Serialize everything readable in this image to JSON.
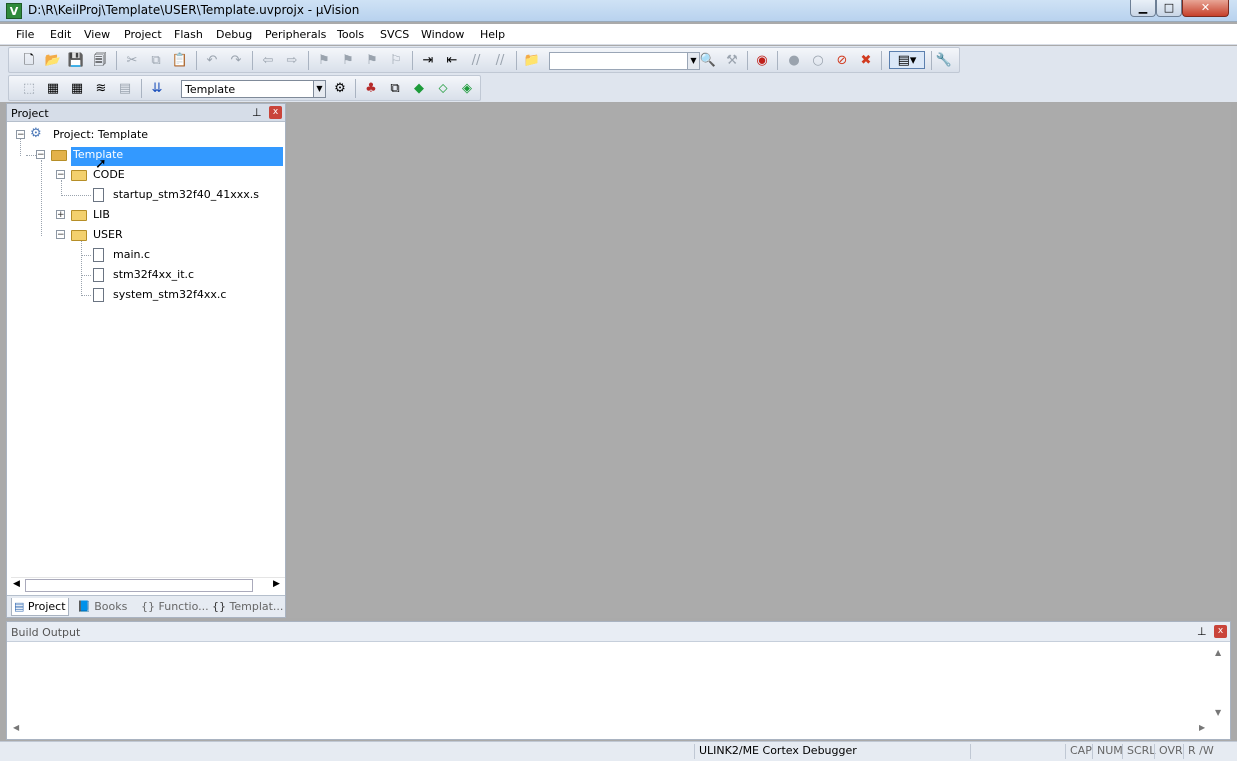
{
  "window": {
    "title": "D:\\R\\KeilProj\\Template\\USER\\Template.uvprojx - µVision",
    "app_icon_letter": "V",
    "minimize_glyph": "▁",
    "maximize_glyph": "□",
    "close_glyph": "✕"
  },
  "menu": [
    "File",
    "Edit",
    "View",
    "Project",
    "Flash",
    "Debug",
    "Peripherals",
    "Tools",
    "SVCS",
    "Window",
    "Help"
  ],
  "toolbar2": {
    "target": "Template"
  },
  "project_pane": {
    "title": "Project",
    "pin_glyph": "📌",
    "close_glyph": "x",
    "tree": {
      "root": "Project: Template",
      "target": "Template",
      "groups": [
        {
          "name": "CODE",
          "expanded": true,
          "files": [
            "startup_stm32f40_41xxx.s"
          ]
        },
        {
          "name": "LIB",
          "expanded": false,
          "files": []
        },
        {
          "name": "USER",
          "expanded": true,
          "files": [
            "main.c",
            "stm32f4xx_it.c",
            "system_stm32f4xx.c"
          ]
        }
      ],
      "selected": "Template"
    },
    "tabs": [
      "Project",
      "Books",
      "{} Functio...",
      "Templat..."
    ]
  },
  "build_output": {
    "title": "Build Output"
  },
  "status": {
    "debugger": "ULINK2/ME Cortex Debugger",
    "indicators": [
      "CAP",
      "NUM",
      "SCRL",
      "OVR",
      "R /W"
    ]
  }
}
